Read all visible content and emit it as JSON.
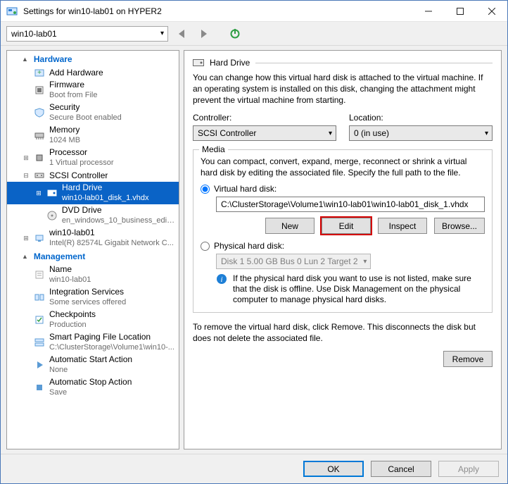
{
  "window": {
    "title": "Settings for win10-lab01 on HYPER2"
  },
  "toolbar": {
    "vm_select": "win10-lab01"
  },
  "tree": {
    "hardware_header": "Hardware",
    "management_header": "Management",
    "items": {
      "add_hardware": "Add Hardware",
      "firmware": "Firmware",
      "firmware_sub": "Boot from File",
      "security": "Security",
      "security_sub": "Secure Boot enabled",
      "memory": "Memory",
      "memory_sub": "1024 MB",
      "processor": "Processor",
      "processor_sub": "1 Virtual processor",
      "scsi": "SCSI Controller",
      "hard_drive": "Hard Drive",
      "hard_drive_sub": "win10-lab01_disk_1.vhdx",
      "dvd": "DVD Drive",
      "dvd_sub": "en_windows_10_business_editi...",
      "nic": "win10-lab01",
      "nic_sub": "Intel(R) 82574L Gigabit Network C...",
      "name": "Name",
      "name_sub": "win10-lab01",
      "integration": "Integration Services",
      "integration_sub": "Some services offered",
      "checkpoints": "Checkpoints",
      "checkpoints_sub": "Production",
      "spf": "Smart Paging File Location",
      "spf_sub": "C:\\ClusterStorage\\Volume1\\win10-...",
      "autostart": "Automatic Start Action",
      "autostart_sub": "None",
      "autostop": "Automatic Stop Action",
      "autostop_sub": "Save"
    }
  },
  "content": {
    "section_title": "Hard Drive",
    "intro": "You can change how this virtual hard disk is attached to the virtual machine. If an operating system is installed on this disk, changing the attachment might prevent the virtual machine from starting.",
    "controller_label": "Controller:",
    "controller_value": "SCSI Controller",
    "location_label": "Location:",
    "location_value": "0 (in use)",
    "media": {
      "label": "Media",
      "desc": "You can compact, convert, expand, merge, reconnect or shrink a virtual hard disk by editing the associated file. Specify the full path to the file.",
      "vhd_label": "Virtual hard disk:",
      "vhd_path": "C:\\ClusterStorage\\Volume1\\win10-lab01\\win10-lab01_disk_1.vhdx",
      "new": "New",
      "edit": "Edit",
      "inspect": "Inspect",
      "browse": "Browse...",
      "phys_label": "Physical hard disk:",
      "phys_value": "Disk 1 5.00 GB Bus 0 Lun 2 Target 2",
      "phys_info": "If the physical hard disk you want to use is not listed, make sure that the disk is offline. Use Disk Management on the physical computer to manage physical hard disks."
    },
    "remove_desc": "To remove the virtual hard disk, click Remove. This disconnects the disk but does not delete the associated file.",
    "remove": "Remove"
  },
  "footer": {
    "ok": "OK",
    "cancel": "Cancel",
    "apply": "Apply"
  }
}
